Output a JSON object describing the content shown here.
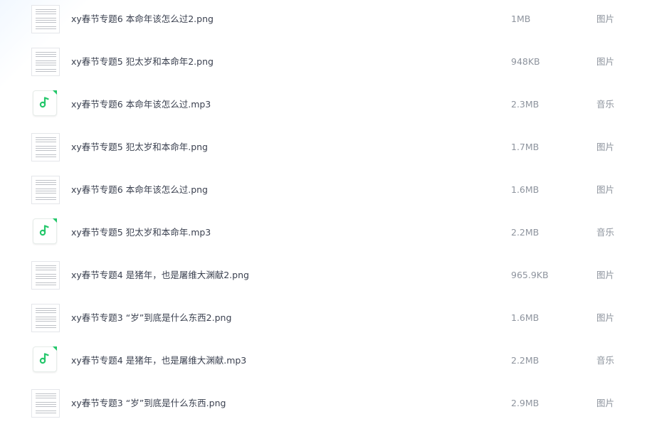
{
  "files": [
    {
      "name": "xy春节专题6 本命年该怎么过2.png",
      "size": "1MB",
      "type": "图片",
      "icon": "image-thumbnail-icon"
    },
    {
      "name": "xy春节专题5 犯太岁和本命年2.png",
      "size": "948KB",
      "type": "图片",
      "icon": "image-thumbnail-icon"
    },
    {
      "name": "xy春节专题6 本命年该怎么过.mp3",
      "size": "2.3MB",
      "type": "音乐",
      "icon": "music-note-icon"
    },
    {
      "name": "xy春节专题5 犯太岁和本命年.png",
      "size": "1.7MB",
      "type": "图片",
      "icon": "image-thumbnail-icon"
    },
    {
      "name": "xy春节专题6 本命年该怎么过.png",
      "size": "1.6MB",
      "type": "图片",
      "icon": "image-thumbnail-icon"
    },
    {
      "name": "xy春节专题5 犯太岁和本命年.mp3",
      "size": "2.2MB",
      "type": "音乐",
      "icon": "music-note-icon"
    },
    {
      "name": "xy春节专题4 是猪年，也是屠维大渊献2.png",
      "size": "965.9KB",
      "type": "图片",
      "icon": "image-thumbnail-icon"
    },
    {
      "name": "xy春节专题3 “岁”到底是什么东西2.png",
      "size": "1.6MB",
      "type": "图片",
      "icon": "image-thumbnail-icon"
    },
    {
      "name": "xy春节专题4 是猪年，也是屠维大渊献.mp3",
      "size": "2.2MB",
      "type": "音乐",
      "icon": "music-note-icon"
    },
    {
      "name": "xy春节专题3 “岁”到底是什么东西.png",
      "size": "2.9MB",
      "type": "图片",
      "icon": "image-thumbnail-icon"
    }
  ],
  "colors": {
    "audio_accent": "#25c76b",
    "name_text": "#3b4150",
    "meta_text": "#8e949e"
  }
}
